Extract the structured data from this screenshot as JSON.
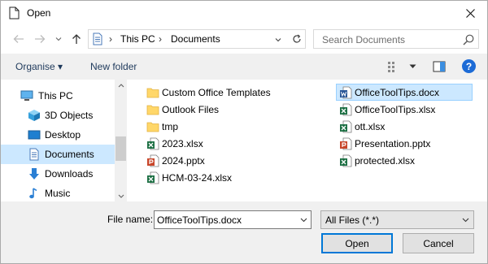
{
  "window": {
    "title": "Open"
  },
  "address": {
    "crumbs": [
      "This PC",
      "Documents"
    ]
  },
  "search": {
    "placeholder": "Search Documents"
  },
  "toolbar": {
    "organise_label": "Organise ▾",
    "new_folder_label": "New folder",
    "help_label": "?"
  },
  "sidebar": {
    "items": [
      {
        "label": "This PC",
        "icon": "computer-icon",
        "level": 0,
        "selected": false
      },
      {
        "label": "3D Objects",
        "icon": "3d-objects-icon",
        "level": 1,
        "selected": false
      },
      {
        "label": "Desktop",
        "icon": "desktop-icon",
        "level": 1,
        "selected": false
      },
      {
        "label": "Documents",
        "icon": "documents-icon",
        "level": 1,
        "selected": true
      },
      {
        "label": "Downloads",
        "icon": "downloads-icon",
        "level": 1,
        "selected": false
      },
      {
        "label": "Music",
        "icon": "music-icon",
        "level": 1,
        "selected": false
      }
    ]
  },
  "files": {
    "column1": [
      {
        "label": "Custom Office Templates",
        "type": "folder"
      },
      {
        "label": "Outlook Files",
        "type": "folder"
      },
      {
        "label": "tmp",
        "type": "folder"
      },
      {
        "label": "2023.xlsx",
        "type": "excel"
      },
      {
        "label": "2024.pptx",
        "type": "powerpoint"
      },
      {
        "label": "HCM-03-24.xlsx",
        "type": "excel"
      }
    ],
    "column2": [
      {
        "label": "OfficeToolTips.docx",
        "type": "word",
        "selected": true
      },
      {
        "label": "OfficeToolTips.xlsx",
        "type": "excel"
      },
      {
        "label": "ott.xlsx",
        "type": "excel"
      },
      {
        "label": "Presentation.pptx",
        "type": "powerpoint"
      },
      {
        "label": "protected.xlsx",
        "type": "excel"
      }
    ]
  },
  "bottom": {
    "filename_label": "File name:",
    "filename_value": "OfficeToolTips.docx",
    "filetype_value": "All Files (*.*)",
    "open_label": "Open",
    "cancel_label": "Cancel"
  },
  "colors": {
    "selection": "#cce8ff",
    "folder": "#ffd769",
    "excel": "#1d7044",
    "word": "#2b5797",
    "powerpoint": "#c8462a",
    "accent": "#0078d7"
  }
}
